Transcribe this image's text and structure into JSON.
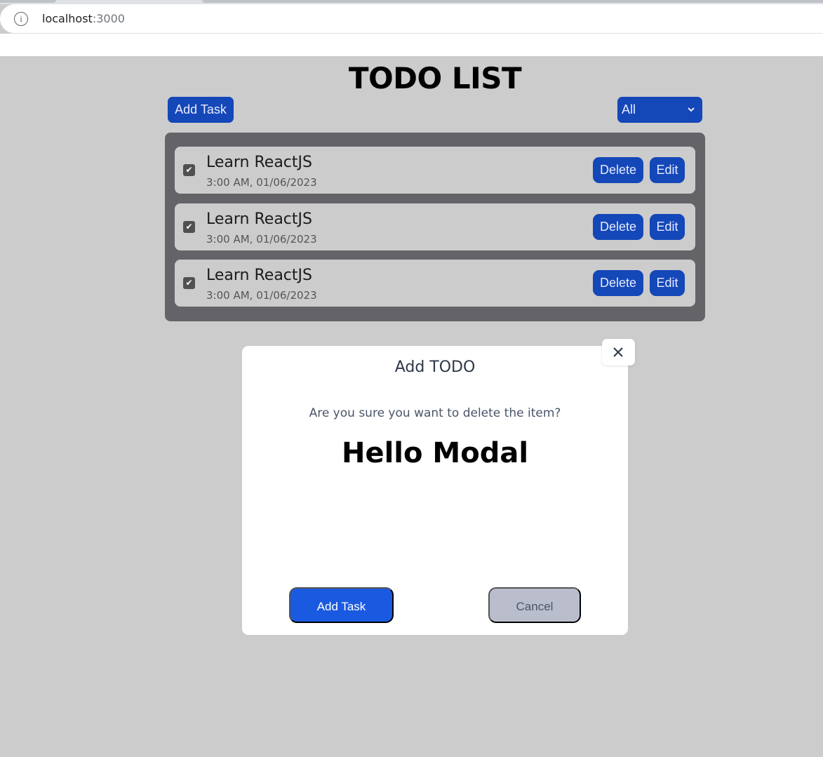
{
  "browser": {
    "url_host": "localhost",
    "url_port": ":3000",
    "info_icon": "info-icon"
  },
  "app": {
    "title": "TODO LIST",
    "add_task_label": "Add Task",
    "filter": {
      "selected": "All",
      "icon": "chevron-down-icon"
    }
  },
  "todos": [
    {
      "title": "Learn ReactJS",
      "time": "3:00 AM, 01/06/2023",
      "checked": true,
      "delete_label": "Delete",
      "edit_label": "Edit"
    },
    {
      "title": "Learn ReactJS",
      "time": "3:00 AM, 01/06/2023",
      "checked": true,
      "delete_label": "Delete",
      "edit_label": "Edit"
    },
    {
      "title": "Learn ReactJS",
      "time": "3:00 AM, 01/06/2023",
      "checked": true,
      "delete_label": "Delete",
      "edit_label": "Edit"
    }
  ],
  "modal": {
    "title": "Add TODO",
    "question": "Are you sure you want to delete the item?",
    "heading": "Hello Modal",
    "confirm_label": "Add Task",
    "cancel_label": "Cancel",
    "close_icon": "close-icon"
  },
  "colors": {
    "page_bg": "#cccccc",
    "primary_button": "#1447b8",
    "modal_primary": "#1a5ae0",
    "modal_cancel": "#babdcb",
    "list_bg": "#646468"
  }
}
